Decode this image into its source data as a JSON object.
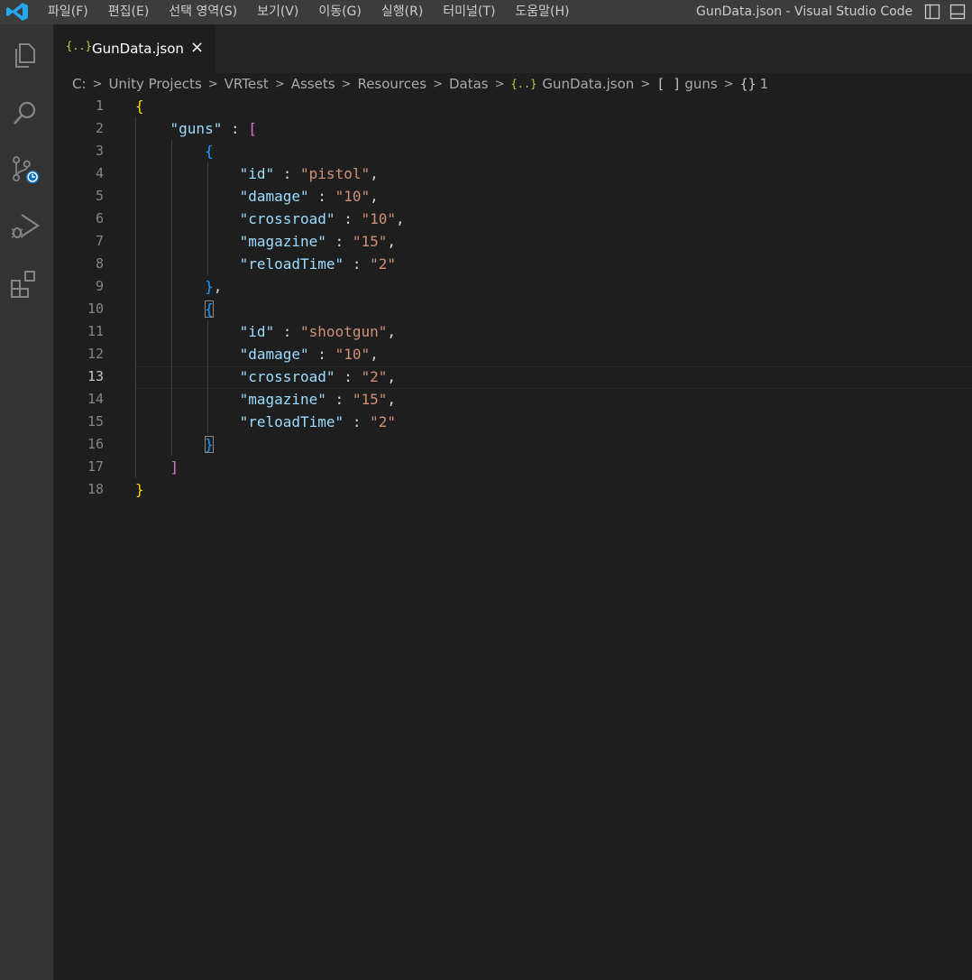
{
  "titlebar": {
    "menu": [
      "파일(F)",
      "편집(E)",
      "선택 영역(S)",
      "보기(V)",
      "이동(G)",
      "실행(R)",
      "터미널(T)",
      "도움말(H)"
    ],
    "window_title": "GunData.json - Visual Studio Code"
  },
  "activitybar": {
    "icons": [
      "explorer-icon",
      "search-icon",
      "source-control-icon",
      "run-debug-icon",
      "extensions-icon"
    ]
  },
  "tab": {
    "icon": "{..}",
    "label": "GunData.json",
    "close": "×"
  },
  "breadcrumb": {
    "items": [
      "C:",
      "Unity Projects",
      "VRTest",
      "Assets",
      "Resources",
      "Datas"
    ],
    "file_icon": "{..}",
    "file": "GunData.json",
    "array_symbol": "[ ]",
    "array_name": "guns",
    "object_symbol": "{}",
    "object_name": "1"
  },
  "editor": {
    "active_line": 13,
    "line_numbers": [
      "1",
      "2",
      "3",
      "4",
      "5",
      "6",
      "7",
      "8",
      "9",
      "10",
      "11",
      "12",
      "13",
      "14",
      "15",
      "16",
      "17",
      "18"
    ],
    "guns": [
      {
        "id": "pistol",
        "damage": "10",
        "crossroad": "10",
        "magazine": "15",
        "reloadTime": "2"
      },
      {
        "id": "shootgun",
        "damage": "10",
        "crossroad": "2",
        "magazine": "15",
        "reloadTime": "2"
      }
    ],
    "code": {
      "l1": "{",
      "l2_key": "\"guns\"",
      "l2_colon": " : ",
      "l2_bracket": "[",
      "l3": "{",
      "l4_key": "\"id\"",
      "l4_val": "\"pistol\"",
      "l5_key": "\"damage\"",
      "l5_val": "\"10\"",
      "l6_key": "\"crossroad\"",
      "l6_val": "\"10\"",
      "l7_key": "\"magazine\"",
      "l7_val": "\"15\"",
      "l8_key": "\"reloadTime\"",
      "l8_val": "\"2\"",
      "l9": "}",
      "l10": "{",
      "l11_key": "\"id\"",
      "l11_val": "\"shootgun\"",
      "l12_key": "\"damage\"",
      "l12_val": "\"10\"",
      "l13_key": "\"crossroad\"",
      "l13_val": "\"2\"",
      "l14_key": "\"magazine\"",
      "l14_val": "\"15\"",
      "l15_key": "\"reloadTime\"",
      "l15_val": "\"2\"",
      "l16": "}",
      "l17": "]",
      "l18": "}"
    }
  },
  "colors": {
    "editor_bg": "#1e1e1e",
    "titlebar_bg": "#3c3c3c",
    "activitybar_bg": "#333333",
    "key": "#9cdcfe",
    "string": "#ce9178",
    "bracket_gold": "#ffd700",
    "bracket_pink": "#da70d6",
    "bracket_blue": "#179fff"
  }
}
